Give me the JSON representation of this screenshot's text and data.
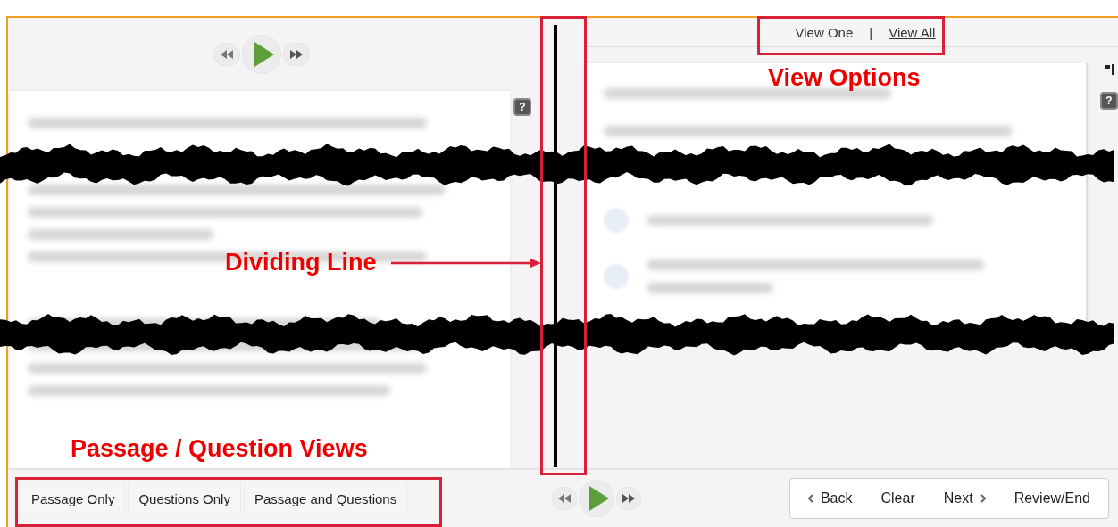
{
  "view_options": [
    {
      "label": "View One",
      "selected": true
    },
    {
      "label": "View All",
      "selected": false
    }
  ],
  "view_separator": "|",
  "passage_help": "?",
  "question_help": "?",
  "choices": [
    {
      "checked": false
    },
    {
      "checked": false
    }
  ],
  "view_buttons": [
    {
      "label": "Passage Only"
    },
    {
      "label": "Questions Only"
    },
    {
      "label": "Passage and Questions"
    }
  ],
  "nav_buttons": [
    {
      "label": "Back",
      "kind": "back"
    },
    {
      "label": "Clear",
      "kind": "plain"
    },
    {
      "label": "Next",
      "kind": "next"
    },
    {
      "label": "Review/End",
      "kind": "plain"
    }
  ],
  "annotations": [
    {
      "text": "View Options",
      "kind": "view-options"
    },
    {
      "text": "Dividing Line",
      "kind": "dividing-line"
    },
    {
      "text": "Passage / Question Views",
      "kind": "views"
    }
  ]
}
